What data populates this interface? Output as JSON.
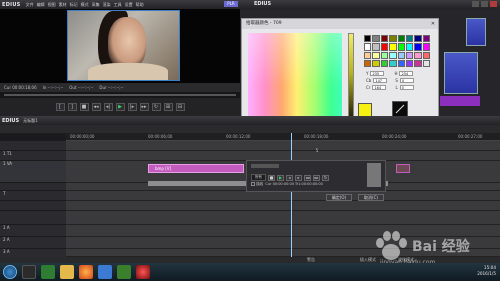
{
  "app": {
    "logo": "EDIUS",
    "menu": [
      "文件",
      "编辑",
      "视图",
      "素材",
      "标记",
      "模式",
      "采集",
      "渲染",
      "工具",
      "设置",
      "帮助"
    ],
    "mode_badge": "PLR"
  },
  "player": {
    "tc_cur": "Cur 00:00:18;06",
    "tc_in": "In --:--:--;--",
    "tc_out": "Out --:--:--;--",
    "tc_dur": "Dur --:--:--;--"
  },
  "right_window": {
    "logo": "EDIUS"
  },
  "color_dialog": {
    "title": "拾取器颜色 - 709",
    "close": "✕",
    "fields": [
      {
        "label": "Y",
        "value": "235",
        "label2": "H",
        "value2": "254"
      },
      {
        "label": "Cb",
        "value": "147",
        "label2": "S",
        "value2": "0"
      },
      {
        "label": "Cr",
        "value": "164",
        "label2": "L",
        "value2": "0"
      }
    ],
    "ire_label": "IRE警告",
    "note": "255 0 16, 0, 233, 0.8 B",
    "ok": "确定",
    "cancel": "取消",
    "swatches": [
      "#000000",
      "#808080",
      "#800000",
      "#808000",
      "#008000",
      "#008080",
      "#000080",
      "#800080",
      "#ffffff",
      "#c0c0c0",
      "#ff0000",
      "#ffff00",
      "#00ff00",
      "#00ffff",
      "#0000ff",
      "#ff00ff",
      "#ffcc99",
      "#ffff99",
      "#99ff99",
      "#99ffff",
      "#99ccff",
      "#cc99ff",
      "#ff99cc",
      "#ff6666",
      "#cc6600",
      "#cccc00",
      "#33cc33",
      "#33cccc",
      "#3366ff",
      "#9933ff",
      "#cc3399",
      "#e5e5e5"
    ],
    "colors": {
      "selected": "#f8f010",
      "accent": "#3cd46a"
    }
  },
  "mini_player": {
    "caption": "5",
    "mode": "所有",
    "check_label": "描线",
    "timecode": "Cur 00:00:00:00  Tr1:00:00:00:00",
    "ok": "确定(O)",
    "cancel": "取消(C)"
  },
  "timeline": {
    "logo": "EDIUS",
    "project": "无标题1",
    "ruler": [
      "00:00:00;00",
      "00:00:06;00",
      "00:00:12;00",
      "00:00:18;00",
      "00:00:24;00"
    ],
    "ruler_last": "00:00:27;00",
    "tracks": [
      "",
      "1 T1",
      "1 VA",
      "",
      "T",
      "",
      "",
      "1 A",
      "2 A",
      "3 A"
    ],
    "clip_label": "bmp [V]"
  },
  "status": {
    "s1": "警告",
    "s2": "插入模式",
    "s3": "波纹模式"
  },
  "taskbar": {
    "clock_time": "15:04",
    "clock_date": "2016/1/5"
  },
  "watermark": {
    "text": "Bai 经验",
    "url": "jingyan.baidu.com"
  }
}
